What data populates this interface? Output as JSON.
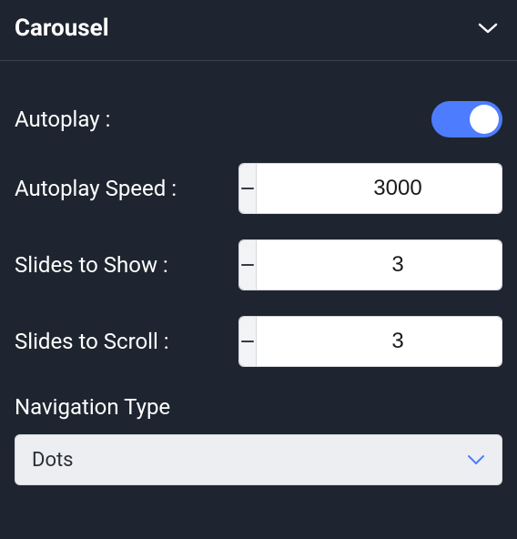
{
  "panel": {
    "title": "Carousel"
  },
  "settings": {
    "autoplay": {
      "label": "Autoplay :",
      "enabled": true
    },
    "autoplay_speed": {
      "label": "Autoplay Speed :",
      "value": "3000"
    },
    "slides_to_show": {
      "label": "Slides to Show :",
      "value": "3"
    },
    "slides_to_scroll": {
      "label": "Slides to Scroll :",
      "value": "3"
    },
    "navigation_type": {
      "label": "Navigation Type",
      "value": "Dots"
    }
  }
}
